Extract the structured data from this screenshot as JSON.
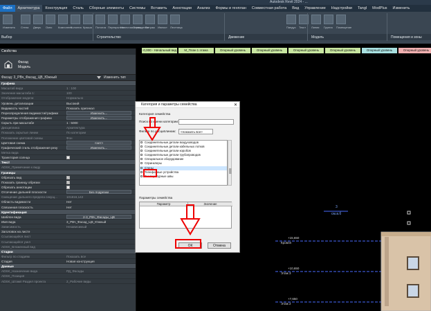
{
  "window": {
    "title": "Autodesk Revit 2024 - ..."
  },
  "ribbon_tabs": [
    "Файл",
    "Архитектура",
    "Конструкция",
    "Сталь",
    "Сборные элементы",
    "Системы",
    "Вставить",
    "Аннотации",
    "Анализ",
    "Формы и генплан",
    "Совместная работа",
    "Вид",
    "Управление",
    "Надстройки",
    "Tangl",
    "ModPlus",
    "Изменить"
  ],
  "ribbon_panels": [
    "Выбор",
    "Строительство",
    "Движение",
    "Модель",
    "Помещения и зоны"
  ],
  "ribbon_tools": [
    "Изменить",
    "Стена",
    "Дверь",
    "Окно",
    "Компонент",
    "Колонна",
    "Крыша",
    "Потолок",
    "Перекрытие",
    "Навесная стена",
    "Ограждение",
    "Витраж",
    "Импост",
    "Лестница",
    "Пандус",
    "Текст",
    "Линия",
    "Группа",
    "Помещение"
  ],
  "levels": [
    {
      "label": "-0,000 - Начальный вид",
      "color": "#c8e6a0"
    },
    {
      "label": "M_План 1 этажа",
      "color": "#c8e6a0"
    },
    {
      "label": "Опорный уровень",
      "color": "#c8e6a0"
    },
    {
      "label": "Опорный уровень",
      "color": "#c8e6a0"
    },
    {
      "label": "Опорный уровень",
      "color": "#c8e6a0"
    },
    {
      "label": "Опорный уровень",
      "color": "#c8e6a0"
    },
    {
      "label": "Опорный уровень",
      "color": "#a8e0e0"
    },
    {
      "label": "Опорный уровень",
      "color": "#f0b0b0"
    }
  ],
  "properties": {
    "header": "Свойства",
    "type_name": "Фасад",
    "type_sub": "Модель",
    "selector": "Фасад: 3_РВч_Фасад_ЦВ_Южный",
    "edit_type": "Изменить тип",
    "rows": [
      {
        "k": "Графика",
        "v": "",
        "type": "group"
      },
      {
        "k": "Масштаб вида",
        "v": "1 : 100",
        "type": "dim"
      },
      {
        "k": "Значение масштаба    1:",
        "v": "100",
        "type": "dim"
      },
      {
        "k": "Отображение модели",
        "v": "Нормально",
        "type": "dim"
      },
      {
        "k": "Уровень детализации",
        "v": "Высокий",
        "type": "norm"
      },
      {
        "k": "Видимость частей",
        "v": "Показать оригинал",
        "type": "norm"
      },
      {
        "k": "Переопределения видимости/графики",
        "v": "Изменить...",
        "type": "btn"
      },
      {
        "k": "Параметры отображения графики",
        "v": "Изменить...",
        "type": "btn"
      },
      {
        "k": "Скрыть при масштабе",
        "v": "1 : 5000",
        "type": "norm"
      },
      {
        "k": "Дисциплина",
        "v": "Архитектура",
        "type": "dim"
      },
      {
        "k": "Показать скрытые линии",
        "v": "По категории",
        "type": "dim"
      },
      {
        "k": "Положение цветовой схемы",
        "v": "Фон",
        "type": "dim"
      },
      {
        "k": "Цветовая схема",
        "v": "<нет>",
        "type": "btn"
      },
      {
        "k": "Графический стиль отображения резу",
        "v": "Изменить...",
        "type": "btn"
      },
      {
        "k": "Метка вида",
        "v": "",
        "type": "dim"
      },
      {
        "k": "Траектория солнца",
        "v": "",
        "type": "cb"
      },
      {
        "k": "Текст",
        "v": "",
        "type": "group"
      },
      {
        "k": "ADSK_Примечание к виду",
        "v": "",
        "type": "dim"
      },
      {
        "k": "Границы",
        "v": "",
        "type": "group"
      },
      {
        "k": "Обрезать вид",
        "v": "on",
        "type": "cb"
      },
      {
        "k": "Показать границу обрезки",
        "v": "on",
        "type": "cb"
      },
      {
        "k": "Обрезать аннотации",
        "v": "",
        "type": "cb"
      },
      {
        "k": "Отсечение дальней плоскости",
        "v": "Без подрезки",
        "type": "btn"
      },
      {
        "k": "Смещение дальнего предела секущ...",
        "v": "101816,142",
        "type": "dim"
      },
      {
        "k": "Область видимости",
        "v": "Нет",
        "type": "norm"
      },
      {
        "k": "Связанная плоскость",
        "v": "Нет",
        "type": "norm"
      },
      {
        "k": "Идентификация",
        "v": "",
        "type": "group"
      },
      {
        "k": "Шаблон вида",
        "v": "2-3_РВч_Фасады_ЦВ",
        "type": "btn"
      },
      {
        "k": "Имя вида",
        "v": "3_РВч_Фасад_ЦВ_Южный",
        "type": "norm"
      },
      {
        "k": "Зависимость",
        "v": "Независимый",
        "type": "dim"
      },
      {
        "k": "Заголовок на листе",
        "v": "",
        "type": "norm"
      },
      {
        "k": "Ссылающийся лист",
        "v": "",
        "type": "dim"
      },
      {
        "k": "Ссылающийся узел",
        "v": "",
        "type": "dim"
      },
      {
        "k": "ADSK_Вложенный вид",
        "v": "",
        "type": "dim"
      },
      {
        "k": "Стадии",
        "v": "",
        "type": "group"
      },
      {
        "k": "Фильтр по стадиям",
        "v": "Показать все",
        "type": "dim"
      },
      {
        "k": "Стадия",
        "v": "Новая конструкция",
        "type": "norm"
      },
      {
        "k": "Данные",
        "v": "",
        "type": "group"
      },
      {
        "k": "ADSK_Назначение вида",
        "v": "РД_Фасады",
        "type": "dim"
      },
      {
        "k": "ADSK_Позиция",
        "v": "",
        "type": "dim"
      },
      {
        "k": "ADSK_Штамп Раздел проекта",
        "v": "2_Рабочие виды",
        "type": "dim"
      }
    ]
  },
  "dialog": {
    "title": "Категория и параметры семейства",
    "category_label": "Категория семейства",
    "search_label": "Поиск по имени категории:",
    "filter_label": "Фильтр по дисциплинам:",
    "filter_value": "<показать все>",
    "list_items": [
      "Соединительные детали воздуховодов",
      "Соединительные детали кабельных лотков",
      "Соединительные детали коробов",
      "Соединительные детали трубопроводов",
      "Специальное оборудование",
      "Спринклеры",
      "Стены",
      "Телефонные устройства",
      "Температурные швы"
    ],
    "selected_item": 6,
    "params_label": "Параметры семейства",
    "col_param": "Параметр",
    "col_value": "Значение",
    "ok": "ОК",
    "cancel": "Отмена"
  },
  "canvas": {
    "label_3": "3",
    "label_3_sub": "см.в.б",
    "elev1": "+15,650",
    "elev1_name": "Кровля",
    "elev2": "+10,650",
    "elev2_name": "Этаж 3",
    "elev3": "+7,650",
    "elev3_name": "Этаж 2"
  }
}
